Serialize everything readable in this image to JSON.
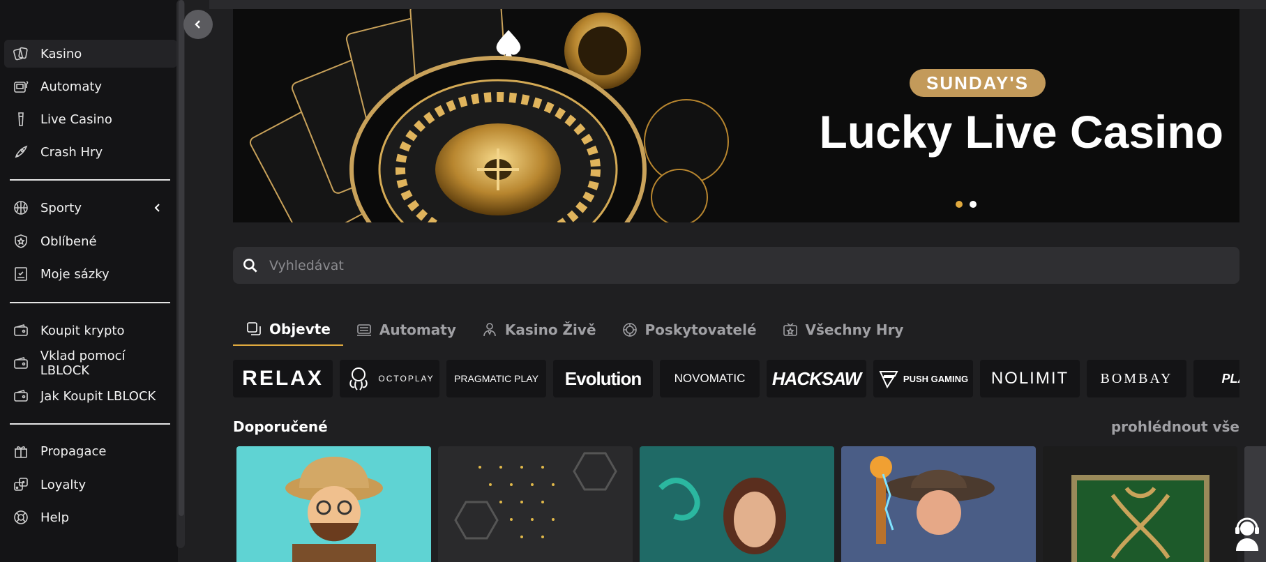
{
  "sidebar": {
    "items": [
      {
        "label": "Kasino",
        "icon": "cards-icon",
        "active": true
      },
      {
        "label": "Automaty",
        "icon": "slot-machine-icon"
      },
      {
        "label": "Live Casino",
        "icon": "dealer-icon"
      },
      {
        "label": "Crash Hry",
        "icon": "rocket-icon"
      },
      {
        "label": "Sporty",
        "icon": "basketball-icon"
      },
      {
        "label": "Oblíbené",
        "icon": "shield-star-icon"
      },
      {
        "label": "Moje sázky",
        "icon": "bet-slip-icon"
      },
      {
        "label": "Koupit krypto",
        "icon": "wallet-icon"
      },
      {
        "label": "Vklad pomocí LBLOCK",
        "icon": "wallet-icon"
      },
      {
        "label": "Jak Koupit LBLOCK",
        "icon": "wallet-icon"
      },
      {
        "label": "Propagace",
        "icon": "gift-icon"
      },
      {
        "label": "Loyalty",
        "icon": "dice-icon"
      },
      {
        "label": "Help",
        "icon": "lifebuoy-icon"
      }
    ]
  },
  "banner": {
    "pill": "SUNDAY'S",
    "title": "Lucky Live Casino"
  },
  "search": {
    "placeholder": "Vyhledávat"
  },
  "tabs": [
    {
      "label": "Objevte",
      "icon": "discover-icon",
      "active": true
    },
    {
      "label": "Automaty",
      "icon": "slot-machine-icon"
    },
    {
      "label": "Kasino Živě",
      "icon": "dealer-icon"
    },
    {
      "label": "Poskytovatelé",
      "icon": "provider-icon"
    },
    {
      "label": "Všechny Hry",
      "icon": "all-games-icon"
    }
  ],
  "providers": [
    "RELAX",
    "OCTOPLAY",
    "PRAGMATIC PLAY",
    "Evolution",
    "NOVOMATIC",
    "HACKSAW",
    "PUSH GAMING",
    "NOLIMIT",
    "BOMBAY",
    "PLAY'n"
  ],
  "recommended": {
    "title": "Doporučené",
    "see_all": "prohlédnout vše"
  },
  "colors": {
    "accent": "#e0a93e",
    "pill": "#c39a5a",
    "sidebar_bg": "#141416",
    "page_bg": "#1f1f21"
  }
}
